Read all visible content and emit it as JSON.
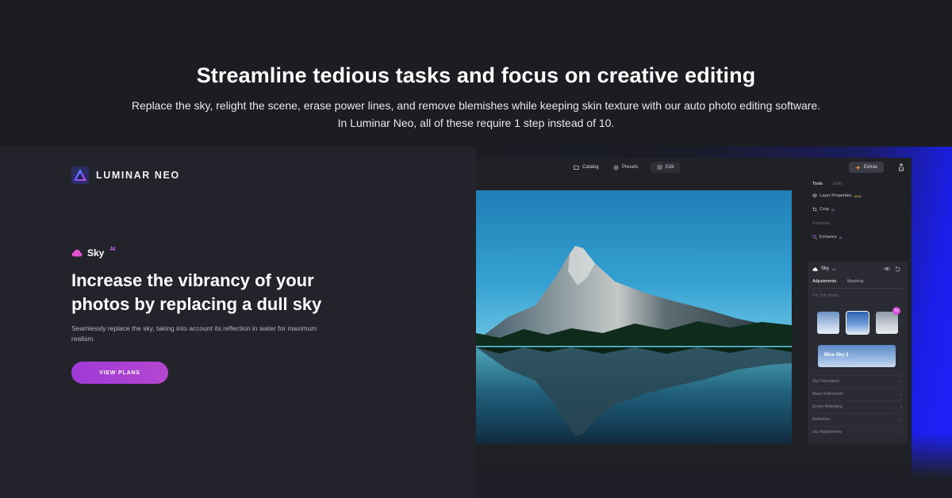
{
  "hero": {
    "headline": "Streamline tedious tasks and focus on creative editing",
    "subline_1": "Replace the sky, relight the scene, erase power lines, and remove blemishes while keeping skin texture with our auto photo editing software.",
    "subline_2": "In Luminar Neo, all of these require 1 step instead of 10."
  },
  "brand": {
    "name": "LUMINAR NEO",
    "logo_icon": "luminar-triangle-icon"
  },
  "feature": {
    "icon": "cloud-icon",
    "name": "Sky",
    "sup": "AI",
    "title": "Increase the vibrancy of your photos by replacing a dull sky",
    "description": "Seamlessly replace the sky, taking into account its reflection in water for maximum realism.",
    "cta_label": "VIEW PLANS"
  },
  "app": {
    "nav": [
      {
        "label": "Catalog",
        "icon": "folder-icon"
      },
      {
        "label": "Presets",
        "icon": "presets-icon"
      },
      {
        "label": "Edit",
        "icon": "sliders-icon"
      }
    ],
    "extras_label": "Extras",
    "panel": {
      "tab_tools": "Tools",
      "tab_edits": "Edits",
      "layer_properties": "Layer Properties",
      "layer_badge": "NEW",
      "crop": "Crop",
      "crop_badge": "AI",
      "favorites": "Favorites",
      "enhance": "Enhance",
      "enhance_badge": "AI",
      "sky_title": "Sky",
      "sky_badge": "AI",
      "sub_adjustments": "Adjustments",
      "sub_masking": "Masking",
      "for_this_photo": "For This Photo",
      "selected_sky": "Blue Sky 3",
      "accordion": [
        "Sky Orientation",
        "Mask Refinement",
        "Scene Relighting",
        "Reflection",
        "Sky Adjustments"
      ]
    }
  },
  "colors": {
    "accent": "#a83fd6",
    "background": "#1e1f26",
    "highlight_blue": "#1e22ff"
  }
}
